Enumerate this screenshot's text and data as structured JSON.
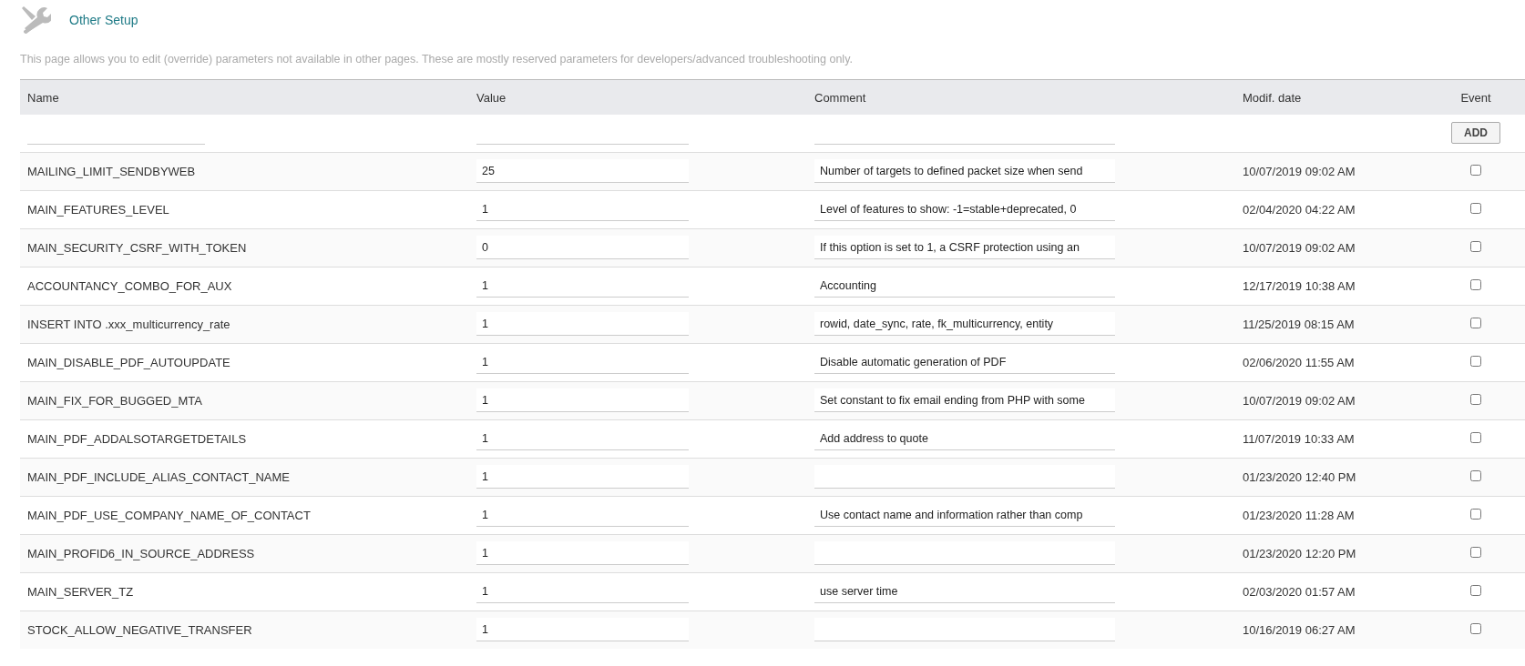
{
  "page": {
    "title": "Other Setup",
    "description": "This page allows you to edit (override) parameters not available in other pages. These are mostly reserved parameters for developers/advanced troubleshooting only."
  },
  "table": {
    "columns": [
      "Name",
      "Value",
      "Comment",
      "Modif. date",
      "Event"
    ],
    "add_button": "ADD",
    "rows": [
      {
        "name": "MAILING_LIMIT_SENDBYWEB",
        "value": "25",
        "comment": "Number of targets to defined packet size when send",
        "date": "10/07/2019 09:02 AM",
        "checked": false
      },
      {
        "name": "MAIN_FEATURES_LEVEL",
        "value": "1",
        "comment": "Level of features to show: -1=stable+deprecated, 0",
        "date": "02/04/2020 04:22 AM",
        "checked": false
      },
      {
        "name": "MAIN_SECURITY_CSRF_WITH_TOKEN",
        "value": "0",
        "comment": "If this option is set to 1, a CSRF protection using an",
        "date": "10/07/2019 09:02 AM",
        "checked": false
      },
      {
        "name": "ACCOUNTANCY_COMBO_FOR_AUX",
        "value": "1",
        "comment": "Accounting",
        "date": "12/17/2019 10:38 AM",
        "checked": false
      },
      {
        "name": "INSERT INTO .xxx_multicurrency_rate",
        "value": "1",
        "comment": "rowid, date_sync, rate, fk_multicurrency, entity",
        "date": "11/25/2019 08:15 AM",
        "checked": false
      },
      {
        "name": "MAIN_DISABLE_PDF_AUTOUPDATE",
        "value": "1",
        "comment": "Disable automatic generation of PDF",
        "date": "02/06/2020 11:55 AM",
        "checked": false
      },
      {
        "name": "MAIN_FIX_FOR_BUGGED_MTA",
        "value": "1",
        "comment": "Set constant to fix email ending from PHP with some",
        "date": "10/07/2019 09:02 AM",
        "checked": false
      },
      {
        "name": "MAIN_PDF_ADDALSOTARGETDETAILS",
        "value": "1",
        "comment": "Add address to quote",
        "date": "11/07/2019 10:33 AM",
        "checked": false
      },
      {
        "name": "MAIN_PDF_INCLUDE_ALIAS_CONTACT_NAME",
        "value": "1",
        "date": "01/23/2020 12:40 PM",
        "checked": false
      },
      {
        "name": "MAIN_PDF_USE_COMPANY_NAME_OF_CONTACT",
        "value": "1",
        "comment": "Use contact name and information rather than comp",
        "date": "01/23/2020 11:28 AM",
        "checked": false
      },
      {
        "name": "MAIN_PROFID6_IN_SOURCE_ADDRESS",
        "value": "1",
        "date": "01/23/2020 12:20 PM",
        "checked": false
      },
      {
        "name": "MAIN_SERVER_TZ",
        "value": "1",
        "comment": "use server time",
        "date": "02/03/2020 01:57 AM",
        "checked": false
      },
      {
        "name": "STOCK_ALLOW_NEGATIVE_TRANSFER",
        "value": "1",
        "date": "10/16/2019 06:27 AM",
        "checked": false
      }
    ]
  }
}
